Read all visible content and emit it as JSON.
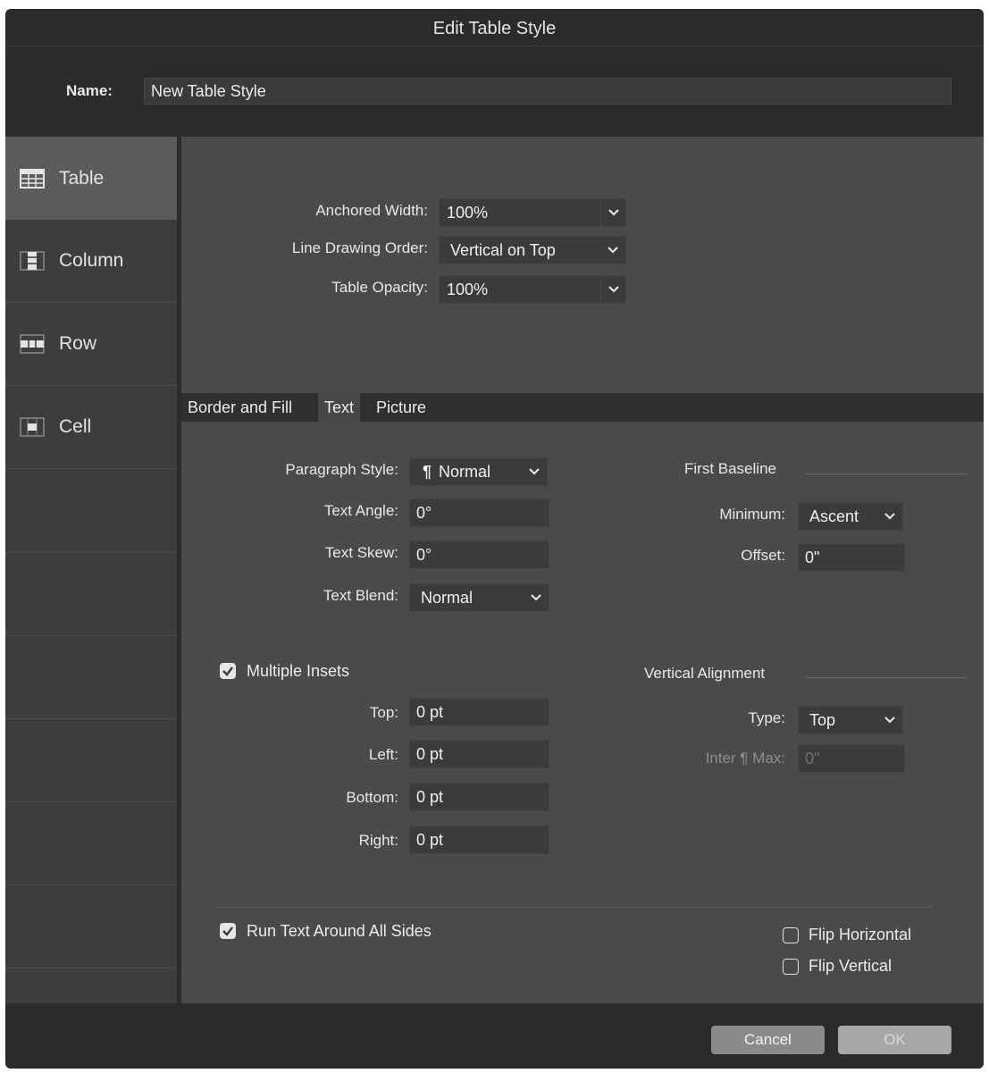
{
  "window": {
    "title": "Edit Table Style"
  },
  "name_field": {
    "label": "Name:",
    "value": "New Table Style"
  },
  "sidebar": {
    "items": [
      {
        "label": "Table",
        "icon": "table-icon",
        "active": true
      },
      {
        "label": "Column",
        "icon": "column-icon",
        "active": false
      },
      {
        "label": "Row",
        "icon": "row-icon",
        "active": false
      },
      {
        "label": "Cell",
        "icon": "cell-icon",
        "active": false
      }
    ]
  },
  "table_props": {
    "anchored_width": {
      "label": "Anchored Width:",
      "value": "100%"
    },
    "line_drawing_order": {
      "label": "Line Drawing Order:",
      "value": "Vertical on Top"
    },
    "table_opacity": {
      "label": "Table Opacity:",
      "value": "100%"
    }
  },
  "tabs": [
    {
      "label": "Border and Fill",
      "active": false
    },
    {
      "label": "Text",
      "active": true
    },
    {
      "label": "Picture",
      "active": false
    }
  ],
  "text_tab": {
    "paragraph_style": {
      "label": "Paragraph Style:",
      "value": "Normal",
      "icon": "pilcrow-icon"
    },
    "text_angle": {
      "label": "Text Angle:",
      "value": "0°"
    },
    "text_skew": {
      "label": "Text Skew:",
      "value": "0°"
    },
    "text_blend": {
      "label": "Text Blend:",
      "value": "Normal"
    },
    "first_baseline": {
      "heading": "First Baseline",
      "minimum": {
        "label": "Minimum:",
        "value": "Ascent"
      },
      "offset": {
        "label": "Offset:",
        "value": "0\""
      }
    },
    "multiple_insets": {
      "label": "Multiple Insets",
      "checked": true
    },
    "insets": {
      "top": {
        "label": "Top:",
        "value": "0 pt"
      },
      "left": {
        "label": "Left:",
        "value": "0 pt"
      },
      "bottom": {
        "label": "Bottom:",
        "value": "0 pt"
      },
      "right": {
        "label": "Right:",
        "value": "0 pt"
      }
    },
    "vertical_alignment": {
      "heading": "Vertical Alignment",
      "type": {
        "label": "Type:",
        "value": "Top"
      },
      "inter_max": {
        "label": "Inter ¶ Max:",
        "value": "0\""
      }
    },
    "run_text_around": {
      "label": "Run Text Around All Sides",
      "checked": true
    },
    "flip_horizontal": {
      "label": "Flip Horizontal",
      "checked": false
    },
    "flip_vertical": {
      "label": "Flip Vertical",
      "checked": false
    }
  },
  "footer": {
    "cancel_label": "Cancel",
    "ok_label": "OK"
  },
  "colors": {
    "dialog_bg": "#2b2b2b",
    "panel_bg": "#4a4a4a",
    "sidebar_bg": "#3d3d3d",
    "active_item_bg": "#5b5b5b",
    "field_bg": "#3b3b3b"
  }
}
